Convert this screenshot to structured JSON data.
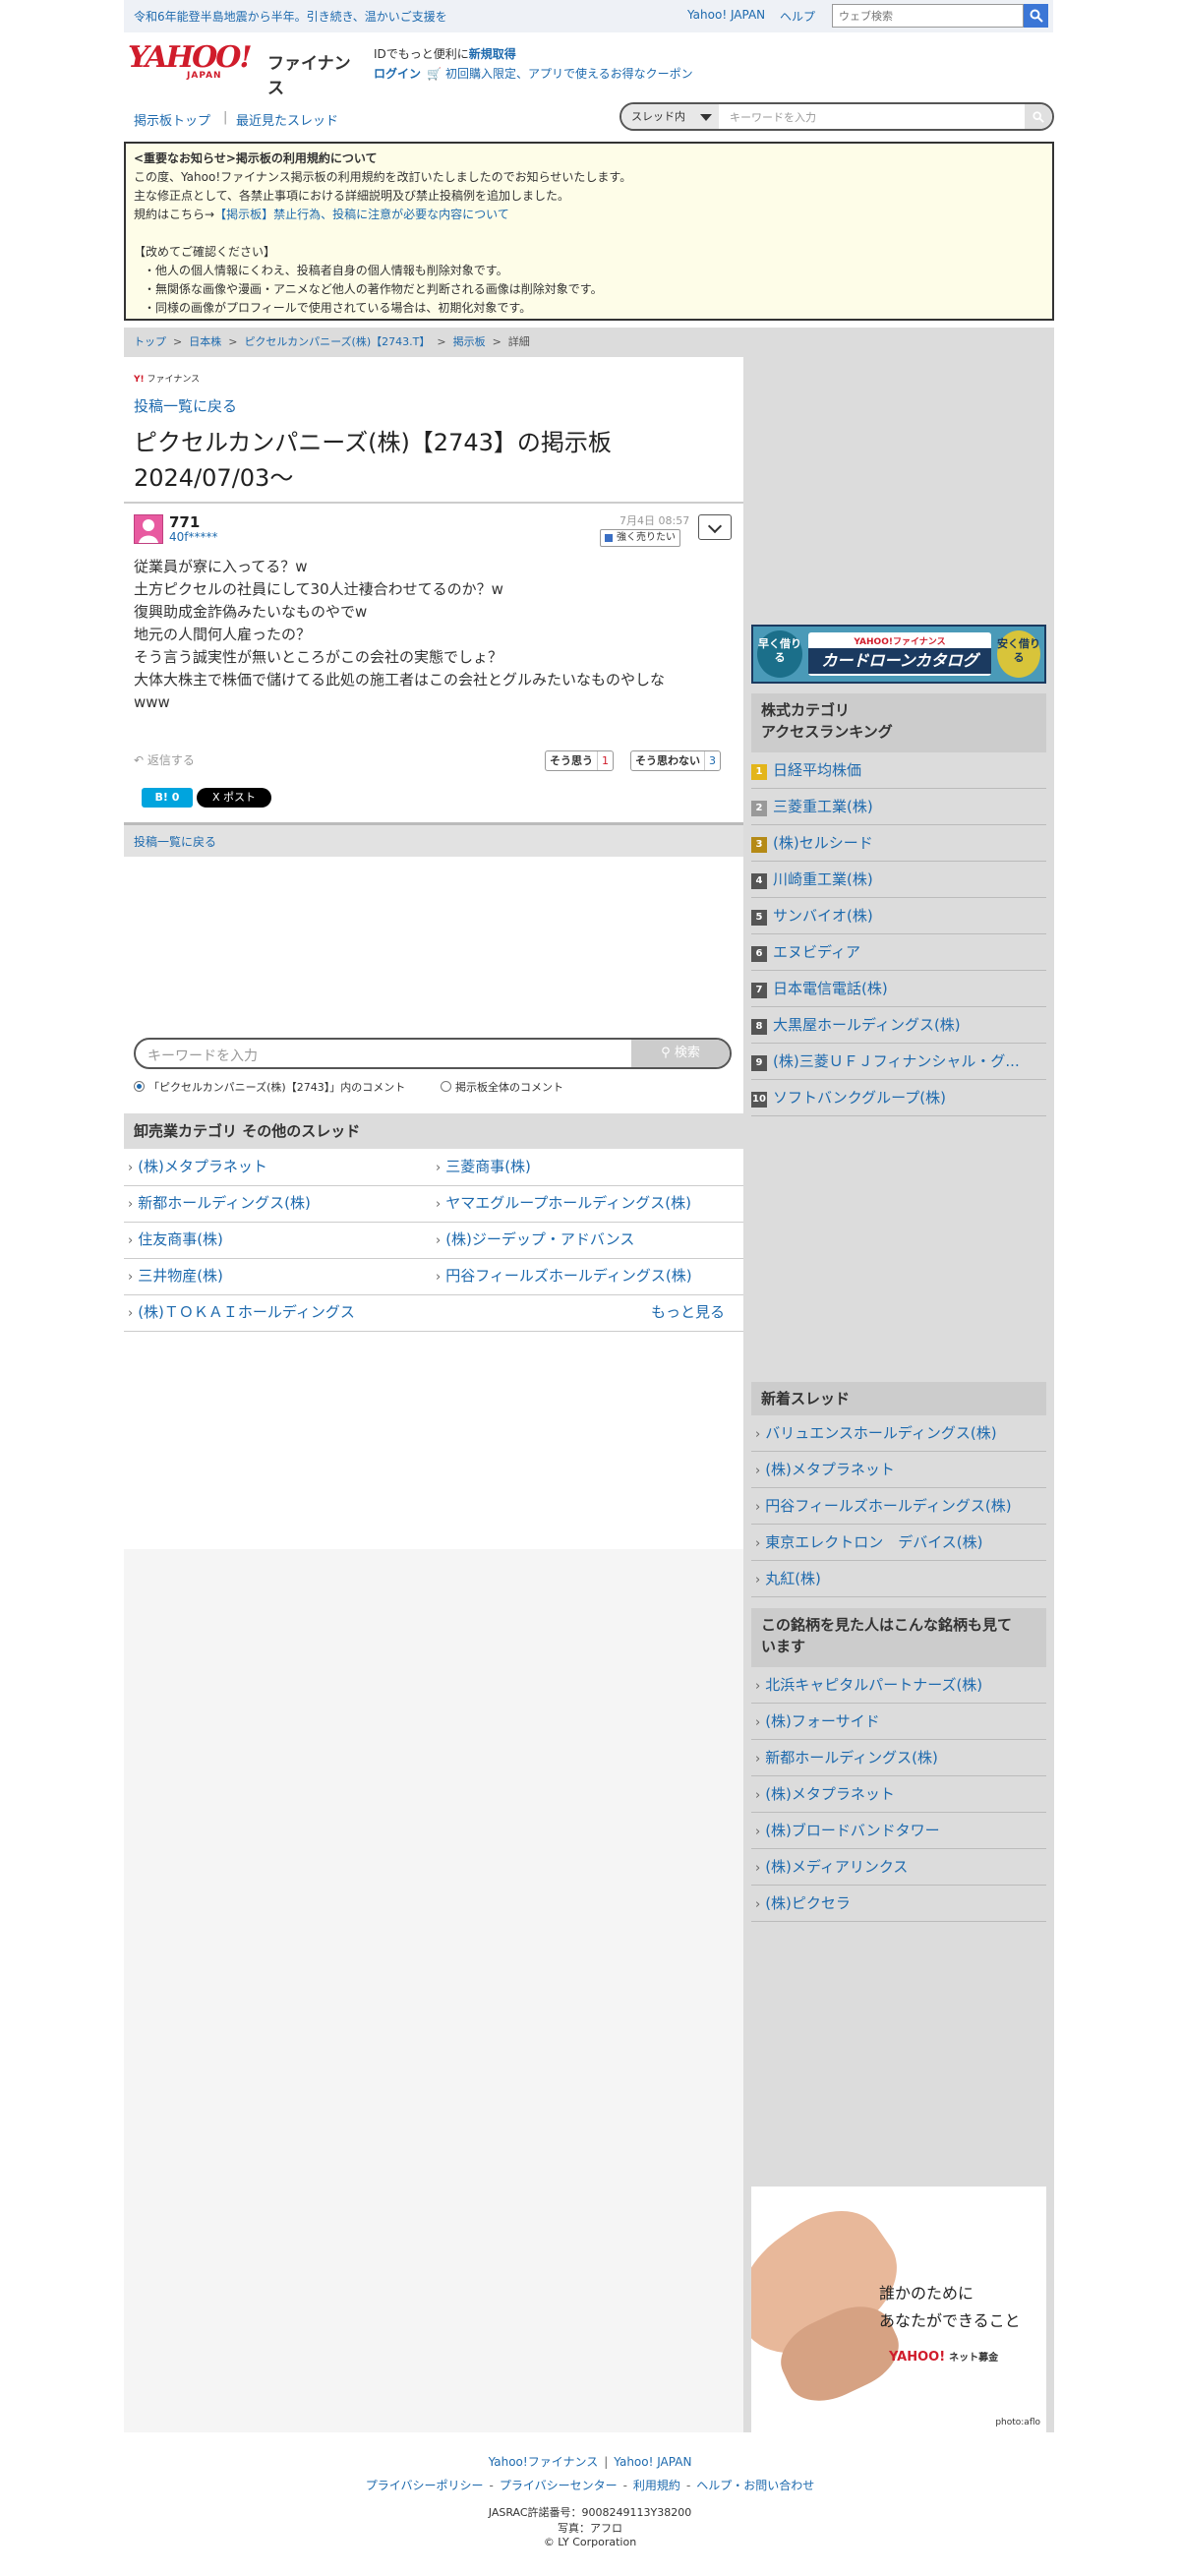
{
  "topbar": {
    "notice": "令和6年能登半島地震から半年。引き続き、温かいご支援を",
    "yahoo_japan": "Yahoo! JAPAN",
    "help": "ヘルプ",
    "search_placeholder": "ウェブ検索",
    "search_icon": "search-icon"
  },
  "header": {
    "logo_yahoo": "YAHOO!",
    "logo_japan": "JAPAN",
    "logo_finance": "ファイナンス",
    "id_text": "IDでもっと便利に",
    "signup": "新規取得",
    "login": "ログイン",
    "coupon": "初回購入限定、アプリで使えるお得なクーポン"
  },
  "nav": {
    "board_top": "掲示板トップ",
    "separator": "|",
    "recent": "最近見たスレッド",
    "scope": "スレッド内",
    "search_placeholder": "キーワードを入力"
  },
  "notice": {
    "title": "<重要なお知らせ>掲示板の利用規約について",
    "line1": "この度、Yahoo!ファイナンス掲示板の利用規約を改訂いたしましたのでお知らせいたします。",
    "line2": "主な修正点として、各禁止事項における詳細説明及び禁止投稿例を追加しました。",
    "line3_prefix": "規約はこちら→",
    "line3_link": "【掲示板】禁止行為、投稿に注意が必要な内容について",
    "confirm": "【改めてご確認ください】",
    "bullet1": "・他人の個人情報にくわえ、投稿者自身の個人情報も削除対象です。",
    "bullet2": "・無関係な画像や漫画・アニメなど他人の著作物だと判断される画像は削除対象です。",
    "bullet3": "・同様の画像がプロフィールで使用されている場合は、初期化対象です。"
  },
  "breadcrumb": {
    "top": "トップ",
    "stocks": "日本株",
    "company": "ピクセルカンパニーズ(株)【2743.T】",
    "board": "掲示板",
    "detail": "詳細",
    "sep": ">"
  },
  "main": {
    "finance_small": "ファイナンス",
    "back": "投稿一覧に戻る",
    "title": "ピクセルカンパニーズ(株)【2743】の掲示板 2024/07/03〜",
    "post": {
      "number": "771",
      "user": "40f*****",
      "date": "7月4日 08:57",
      "badge": "強く売りたい",
      "body": [
        "従業員が寮に入ってる？w",
        "土方ピクセルの社員にして30人辻褄合わせてるのか？w",
        "復興助成金詐偽みたいなものやでw",
        "地元の人間何人雇ったの？",
        "そう言う誠実性が無いところがこの会社の実態でしょ？",
        "大体大株主で株価で儲けてる此処の施工者はこの会社とグルみたいなものやしな",
        "www"
      ],
      "reply": "返信する",
      "agree_label": "そう思う",
      "agree_count": "1",
      "disagree_label": "そう思わない",
      "disagree_count": "3",
      "hatena": "B! 0",
      "xpost": "X ポスト"
    },
    "back2": "投稿一覧に戻る",
    "keyword_placeholder": "キーワードを入力",
    "keyword_btn": "検索",
    "radio_thread": "「ピクセルカンパニーズ(株)【2743】」内のコメント",
    "radio_all": "掲示板全体のコメント",
    "other_head": "卸売業カテゴリ その他のスレッド",
    "other_threads": [
      "(株)メタプラネット",
      "三菱商事(株)",
      "新都ホールディングス(株)",
      "ヤマエグループホールディングス(株)",
      "住友商事(株)",
      "(株)ジーデップ・アドバンス",
      "三井物産(株)",
      "円谷フィールズホールディングス(株)",
      "(株)ＴＯＫＡＩホールディングス"
    ],
    "more": "もっと見る"
  },
  "sidebar": {
    "banner_left": "早く借りる",
    "banner_yj": "YAHOO!ファイナンス",
    "banner_title": "カードローンカタログ",
    "banner_right": "安く借りる",
    "ranking_head": "株式カテゴリ\nアクセスランキング",
    "ranking_head_1": "株式カテゴリ",
    "ranking_head_2": "アクセスランキング",
    "ranking": [
      {
        "rank": "1",
        "name": "日経平均株価"
      },
      {
        "rank": "2",
        "name": "三菱重工業(株)"
      },
      {
        "rank": "3",
        "name": "(株)セルシード"
      },
      {
        "rank": "4",
        "name": "川崎重工業(株)"
      },
      {
        "rank": "5",
        "name": "サンバイオ(株)"
      },
      {
        "rank": "6",
        "name": "エヌビディア"
      },
      {
        "rank": "7",
        "name": "日本電信電話(株)"
      },
      {
        "rank": "8",
        "name": "大黒屋ホールディングス(株)"
      },
      {
        "rank": "9",
        "name": "(株)三菱ＵＦＪフィナンシャル・グ..."
      },
      {
        "rank": "10",
        "name": "ソフトバンクグループ(株)"
      }
    ],
    "new_head": "新着スレッド",
    "new_threads": [
      "バリュエンスホールディングス(株)",
      "(株)メタプラネット",
      "円谷フィールズホールディングス(株)",
      "東京エレクトロン　デバイス(株)",
      "丸紅(株)"
    ],
    "viewed_head_1": "この銘柄を見た人はこんな銘柄も見て",
    "viewed_head_2": "います",
    "viewed": [
      "北浜キャピタルパートナーズ(株)",
      "(株)フォーサイド",
      "新都ホールディングス(株)",
      "(株)メタプラネット",
      "(株)ブロードバンドタワー",
      "(株)メディアリンクス",
      "(株)ピクセラ"
    ],
    "ad_copy_1": "誰かのために",
    "ad_copy_2": "あなたができること",
    "ad_yj": "YAHOO!",
    "ad_yj_sub": "ネット募金",
    "ad_photo": "photo:aflo"
  },
  "footer": {
    "finance": "Yahoo!ファイナンス",
    "yj": "Yahoo! JAPAN",
    "privacy_policy": "プライバシーポリシー",
    "privacy_center": "プライバシーセンター",
    "terms": "利用規約",
    "help": "ヘルプ・お問い合わせ",
    "jasrac": "JASRAC許諾番号：9008249113Y38200",
    "photo": "写真：アフロ",
    "copyright": "© LY Corporation"
  }
}
